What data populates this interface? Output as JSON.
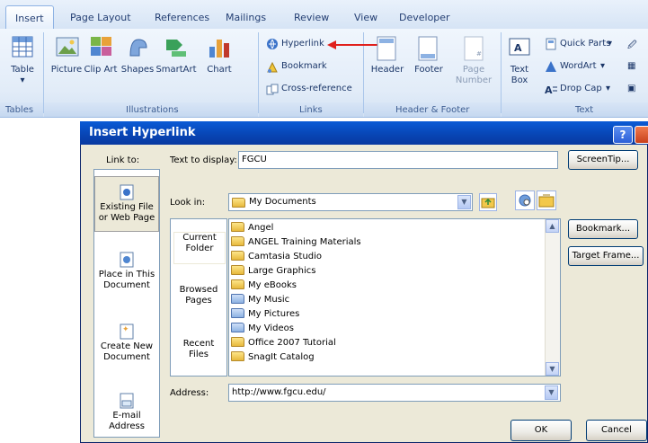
{
  "ribbon": {
    "tabs": [
      "Insert",
      "Page Layout",
      "References",
      "Mailings",
      "Review",
      "View",
      "Developer"
    ],
    "groups": {
      "tables": {
        "label": "Tables",
        "table": "Table"
      },
      "illustrations": {
        "label": "Illustrations",
        "picture": "Picture",
        "clip_art": "Clip Art",
        "shapes": "Shapes",
        "smartart": "SmartArt",
        "chart": "Chart"
      },
      "links": {
        "label": "Links",
        "hyperlink": "Hyperlink",
        "bookmark": "Bookmark",
        "cross_reference": "Cross-reference"
      },
      "header_footer": {
        "label": "Header & Footer",
        "header": "Header",
        "footer": "Footer",
        "page_number": "Page Number"
      },
      "text": {
        "label": "Text",
        "text_box": "Text Box",
        "quick_parts": "Quick Parts",
        "wordart": "WordArt",
        "drop_cap": "Drop Cap"
      }
    },
    "arrow_color": "#e0201c"
  },
  "dialog": {
    "title": "Insert Hyperlink",
    "link_to_label": "Link to:",
    "text_to_display_label": "Text to display:",
    "text_to_display_value": "FGCU",
    "screentip_label": "ScreenTip...",
    "look_in_label": "Look in:",
    "look_in_value": "My Documents",
    "link_to_items": [
      "Existing File or Web Page",
      "Place in This Document",
      "Create New Document",
      "E-mail Address"
    ],
    "browse_items": [
      "Current Folder",
      "Browsed Pages",
      "Recent Files"
    ],
    "files": [
      "Angel",
      "ANGEL Training Materials",
      "Camtasia Studio",
      "Large Graphics",
      "My eBooks",
      "My Music",
      "My Pictures",
      "My Videos",
      "Office 2007 Tutorial",
      "SnagIt Catalog"
    ],
    "bookmark_label": "Bookmark...",
    "target_frame_label": "Target Frame...",
    "address_label": "Address:",
    "address_value": "http://www.fgcu.edu/",
    "ok_label": "OK",
    "cancel_label": "Cancel",
    "help_label": "?"
  }
}
